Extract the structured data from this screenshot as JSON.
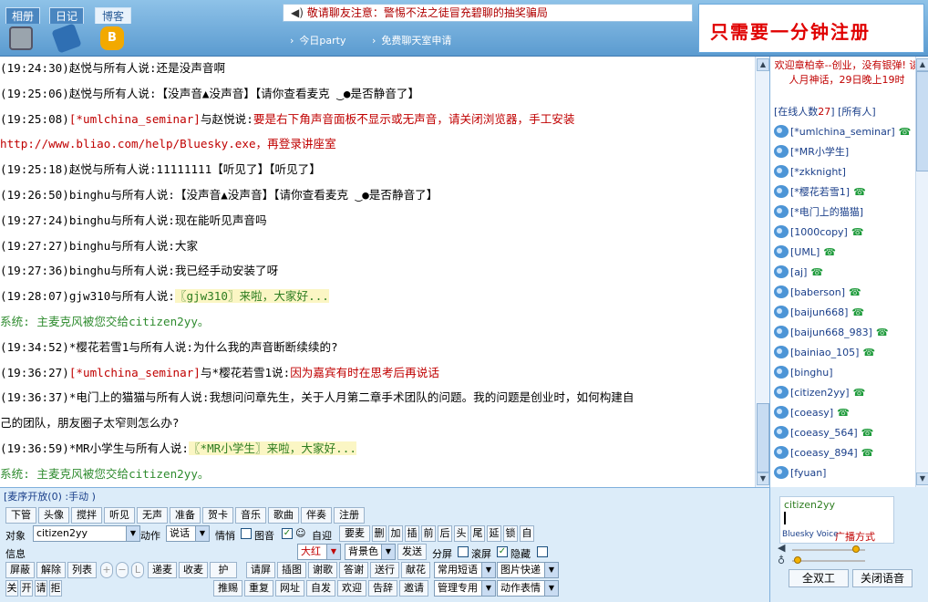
{
  "tabs": [
    "相册",
    "日记",
    "博客"
  ],
  "notice": "敬请聊友注意：警惕不法之徒冒充碧聊的抽奖骗局",
  "nav": [
    "今日party",
    "免费聊天室申请"
  ],
  "register": "只需要一分钟注册",
  "chat": [
    {
      "parts": [
        {
          "t": "(19:24:30)赵悦与所有人说:还是没声音啊"
        }
      ]
    },
    {
      "parts": [
        {
          "t": "(19:25:06)赵悦与所有人说:【没声音▲没声音】【请你查看麦克 ‿●是否静音了】"
        }
      ]
    },
    {
      "parts": [
        {
          "t": "(19:25:08)"
        },
        {
          "t": "[*umlchina_seminar]",
          "c": "red"
        },
        {
          "t": "与赵悦说:"
        },
        {
          "t": "要是右下角声音面板不显示或无声音，请关闭浏览器，手工安装",
          "c": "red"
        }
      ]
    },
    {
      "parts": [
        {
          "t": "http://www.bliao.com/help/Bluesky.exe，再登录讲座室",
          "c": "red"
        }
      ]
    },
    {
      "parts": [
        {
          "t": "(19:25:18)赵悦与所有人说:11111111【听见了】【听见了】"
        }
      ]
    },
    {
      "parts": [
        {
          "t": "(19:26:50)binghu与所有人说:【没声音▲没声音】【请你查看麦克 ‿●是否静音了】"
        }
      ]
    },
    {
      "parts": [
        {
          "t": "(19:27:24)binghu与所有人说:现在能听见声音吗"
        }
      ]
    },
    {
      "parts": [
        {
          "t": "(19:27:27)binghu与所有人说:大家"
        }
      ]
    },
    {
      "parts": [
        {
          "t": "(19:27:36)binghu与所有人说:我已经手动安装了呀"
        }
      ]
    },
    {
      "parts": [
        {
          "t": "(19:28:07)gjw310与所有人说:"
        },
        {
          "t": "〖gjw310〗来啦，大家好...",
          "c": "hl"
        }
      ]
    },
    {
      "parts": [
        {
          "t": "系统:   主麦克风被您交给citizen2yy。",
          "c": "sys"
        }
      ]
    },
    {
      "parts": [
        {
          "t": "(19:34:52)*樱花若雪1与所有人说:为什么我的声音断断续续的?"
        }
      ]
    },
    {
      "parts": [
        {
          "t": "(19:36:27)"
        },
        {
          "t": "[*umlchina_seminar]",
          "c": "red"
        },
        {
          "t": "与*樱花若雪1说:"
        },
        {
          "t": "因为嘉宾有时在思考后再说话",
          "c": "red"
        }
      ]
    },
    {
      "parts": [
        {
          "t": "(19:36:37)*电门上的猫猫与所有人说:我想问问章先生，关于人月第二章手术团队的问题。我的问题是创业时，如何构建自"
        }
      ]
    },
    {
      "parts": [
        {
          "t": "己的团队，朋友圈子太窄则怎么办?"
        }
      ]
    },
    {
      "parts": [
        {
          "t": "(19:36:59)*MR小学生与所有人说:"
        },
        {
          "t": "〖*MR小学生〗来啦，大家好...",
          "c": "hl"
        }
      ]
    },
    {
      "parts": [
        {
          "t": "系统:   主麦克风被您交给citizen2yy。",
          "c": "sys"
        }
      ]
    }
  ],
  "welcome": "欢迎章柏幸--创业，没有银弹! 读人月神话，29日晚上19时",
  "online_prefix": "[在线人数",
  "online_count": "27",
  "online_suffix": "]",
  "all_people": "[所有人]",
  "users": [
    {
      "name": "[*umlchina_seminar]",
      "phone": true
    },
    {
      "name": "[*MR小学生]",
      "phone": false
    },
    {
      "name": "[*zkknight]",
      "phone": false
    },
    {
      "name": "[*樱花若雪1]",
      "phone": true
    },
    {
      "name": "[*电门上的猫猫]",
      "phone": false
    },
    {
      "name": "[1000copy]",
      "phone": true
    },
    {
      "name": "[UML]",
      "phone": true
    },
    {
      "name": "[aj]",
      "phone": true
    },
    {
      "name": "[baberson]",
      "phone": true
    },
    {
      "name": "[baijun668]",
      "phone": true
    },
    {
      "name": "[baijun668_983]",
      "phone": true
    },
    {
      "name": "[bainiao_105]",
      "phone": true
    },
    {
      "name": "[binghu]",
      "phone": false
    },
    {
      "name": "[citizen2yy]",
      "phone": true
    },
    {
      "name": "[coeasy]",
      "phone": true
    },
    {
      "name": "[coeasy_564]",
      "phone": true
    },
    {
      "name": "[coeasy_894]",
      "phone": true
    },
    {
      "name": "[fyuan]",
      "phone": false
    }
  ],
  "mode": "[麦序开放(0) :手动 )",
  "row1": [
    "下管",
    "头像",
    "搅拌",
    "听见",
    "无声",
    "准备",
    "贺卡",
    "音乐",
    "歌曲",
    "伴奏",
    "注册"
  ],
  "target_label": "对象",
  "target_value": "citizen2yy",
  "action_label": "动作",
  "action_value": "说话",
  "emotion_label": "情悄",
  "image_label": "图音",
  "welcome_btn": "自迎",
  "row2": [
    "要麦",
    "删",
    "加",
    "插",
    "前",
    "后",
    "头",
    "尾",
    "延",
    "锁",
    "自"
  ],
  "info_label": "信息",
  "size_value": "大红",
  "bg_value": "背景色",
  "send": "发送",
  "split_label": "分屏",
  "scroll_label": "滚屏",
  "hide_label": "隐藏",
  "row4a": [
    "屏蔽",
    "解除",
    "列表"
  ],
  "row4b": [
    "递麦",
    "收麦",
    "护"
  ],
  "row4c": [
    "请屏",
    "插图",
    "谢歌",
    "答谢",
    "送行",
    "献花"
  ],
  "common": "常用短语",
  "image_fast": "图片快递",
  "row5": [
    "关",
    "开",
    "请",
    "拒"
  ],
  "row5b": [
    "推赐",
    "重复",
    "网址",
    "自发",
    "欢迎",
    "告辞",
    "邀请"
  ],
  "manage": "管理专用",
  "anim": "动作表情",
  "voice_name": "citizen2yy",
  "voice_brand": "Bluesky Voice",
  "voice_mode": "广播方式",
  "duplex": "全双工",
  "close_voice": "关闭语音",
  "colors": {
    "accent": "#5b9bd0",
    "red": "#c00000",
    "green": "#2e7d20"
  }
}
